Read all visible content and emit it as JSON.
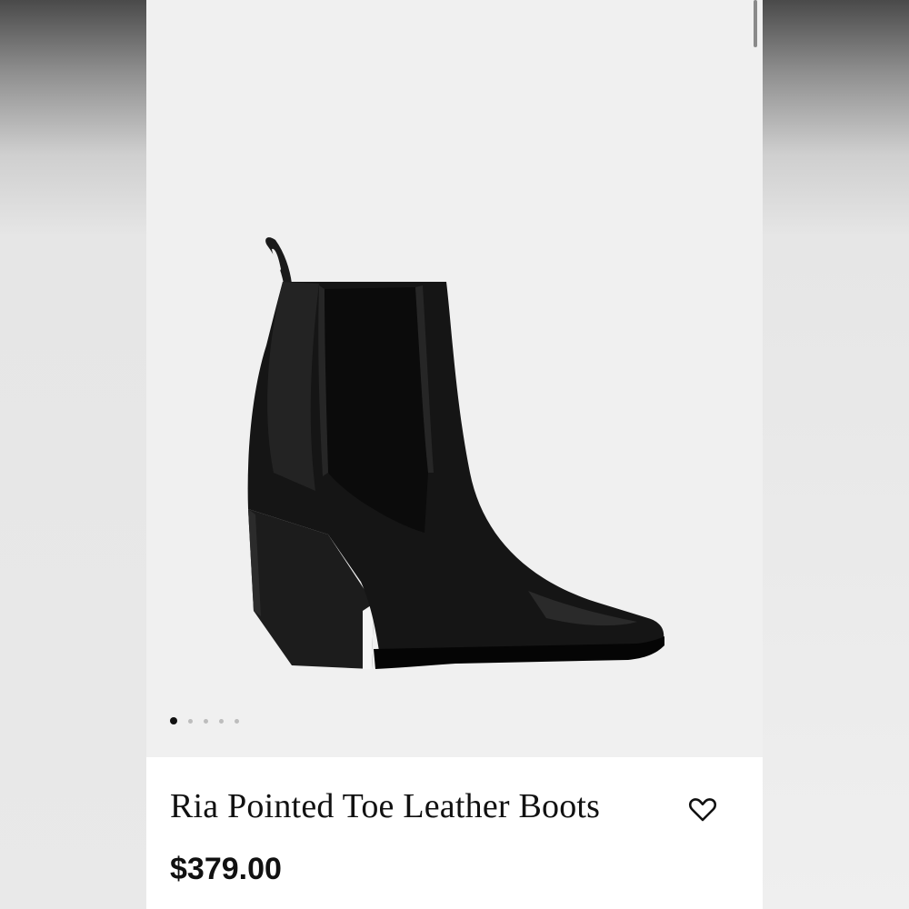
{
  "product": {
    "title": "Ria Pointed Toe Leather Boots",
    "price": "$379.00"
  },
  "gallery": {
    "image": "black-leather-ankle-boot-image",
    "slide_count": 5,
    "active_slide": 1
  },
  "icons": {
    "wishlist": "heart-outline-icon"
  },
  "colors": {
    "text": "#111111",
    "gallery_background": "#f0f0f0",
    "info_background": "#ffffff",
    "dot_active": "#111111",
    "dot_inactive": "#bdbdbd"
  }
}
